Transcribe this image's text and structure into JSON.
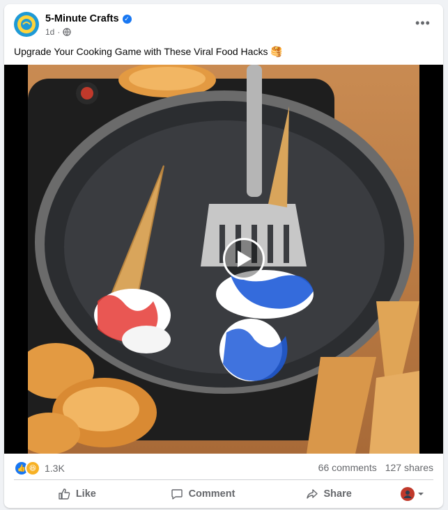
{
  "post": {
    "page_name": "5-Minute Crafts",
    "verified_icon": "verified-badge-icon",
    "time": "1d",
    "audience_icon": "globe-icon",
    "caption": "Upgrade Your Cooking Game with These Viral Food Hacks 🥞"
  },
  "stats": {
    "reaction_icons": [
      "like-icon",
      "haha-icon"
    ],
    "reaction_count": "1.3K",
    "comments": "66 comments",
    "shares": "127 shares"
  },
  "actions": {
    "like": "Like",
    "comment": "Comment",
    "share": "Share"
  },
  "colors": {
    "accent": "#1877f2",
    "background": "#f0f2f5",
    "muted_text": "#65676b"
  }
}
